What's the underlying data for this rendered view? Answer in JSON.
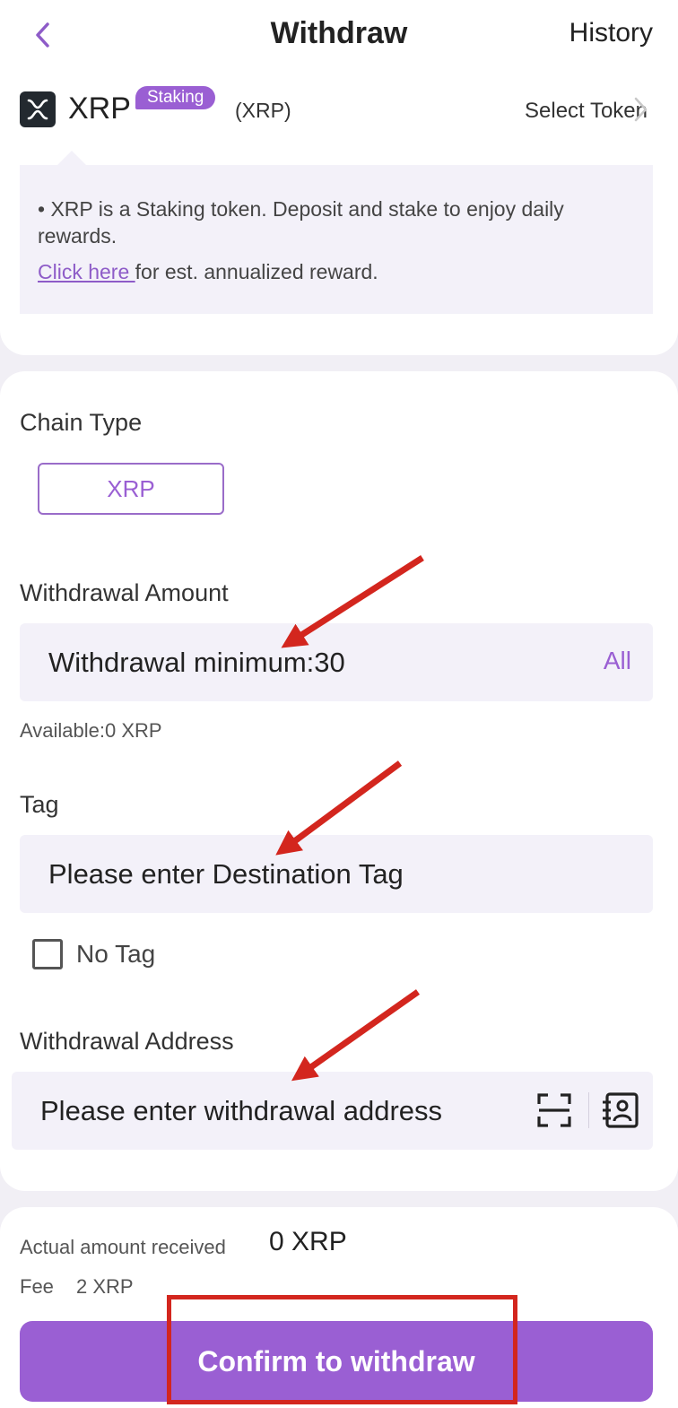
{
  "header": {
    "title": "Withdraw",
    "history_label": "History"
  },
  "token": {
    "name": "XRP",
    "badge": "Staking",
    "code": "(XRP)",
    "select_label": "Select Token"
  },
  "notice": {
    "line1": "• XRP is a Staking token. Deposit and stake to enjoy daily rewards.",
    "link_text": "Click here ",
    "line2_rest": "for est. annualized reward."
  },
  "chain": {
    "label": "Chain Type",
    "selected": "XRP"
  },
  "amount": {
    "label": "Withdrawal Amount",
    "placeholder": "Withdrawal minimum:30",
    "all_label": "All",
    "available": "Available:0 XRP"
  },
  "tag": {
    "label": "Tag",
    "placeholder": "Please enter Destination Tag",
    "no_tag_label": "No Tag"
  },
  "address": {
    "label": "Withdrawal Address",
    "placeholder": "Please enter withdrawal address"
  },
  "summary": {
    "received_label": "Actual amount received",
    "received_value": "0 XRP",
    "fee_label": "Fee",
    "fee_value": "2 XRP"
  },
  "confirm_label": "Confirm to withdraw",
  "colors": {
    "accent": "#9a5fd3",
    "annotation": "#d3261e",
    "field_bg": "#f3f1f9"
  },
  "icons": {
    "back": "chevron-left-icon",
    "select": "chevron-right-icon",
    "token": "xrp-logo-icon",
    "scan": "scan-icon",
    "address_book": "address-book-icon"
  }
}
